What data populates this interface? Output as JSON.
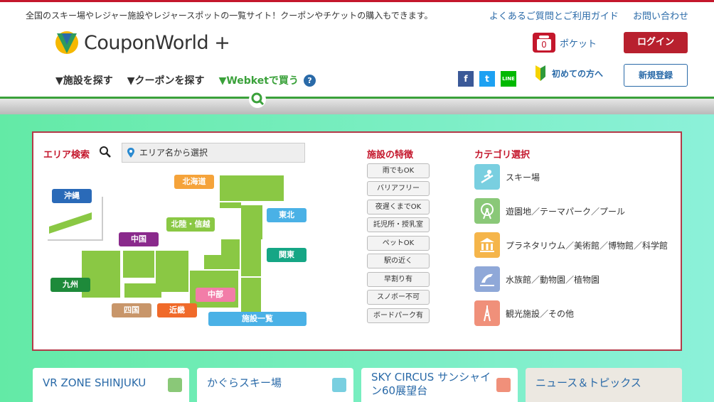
{
  "header": {
    "tagline": "全国のスキー場やレジャー施設やレジャースポットの一覧サイト！クーポンやチケットの購入もできます。",
    "links": [
      "よくあるご質問とご利用ガイド",
      "お問い合わせ"
    ],
    "logo_text": "CouponWorld",
    "logo_plus": "+",
    "nav": [
      "▼施設を探す",
      "▼クーポンを探す",
      "▼Webketで買う"
    ],
    "help_mark": "?",
    "pocket_count": "0",
    "pocket_label": "ポケット",
    "login": "ログイン",
    "beginner": "初めての方へ",
    "signup": "新規登録",
    "social": [
      "f",
      "t",
      "LINE"
    ]
  },
  "area": {
    "title": "エリア検索",
    "select_placeholder": "エリア名から選択",
    "regions": [
      "北海道",
      "沖縄",
      "東北",
      "北陸・信越",
      "中国",
      "関東",
      "九州",
      "中部",
      "四国",
      "近畿",
      "施設一覧"
    ]
  },
  "features": {
    "title": "施設の特徴",
    "items": [
      "雨でもOK",
      "バリアフリー",
      "夜遅くまでOK",
      "託児所・授乳室",
      "ペットOK",
      "駅の近く",
      "早割り有",
      "スノボー不可",
      "ボードパーク有"
    ]
  },
  "categories": {
    "title": "カテゴリ選択",
    "items": [
      "スキー場",
      "遊園地／テーマパーク／プール",
      "プラネタリウム／美術館／博物館／科学館",
      "水族館／動物園／植物園",
      "観光施設／その他"
    ]
  },
  "cards": [
    "VR ZONE SHINJUKU",
    "かぐらスキー場",
    "SKY CIRCUS サンシャイン60展望台",
    "ニュース＆トピックス"
  ],
  "colors": {
    "brand_red": "#c4172c",
    "link_blue": "#2a6aa8",
    "green": "#3aa13a",
    "map_green": "#8ac844"
  }
}
